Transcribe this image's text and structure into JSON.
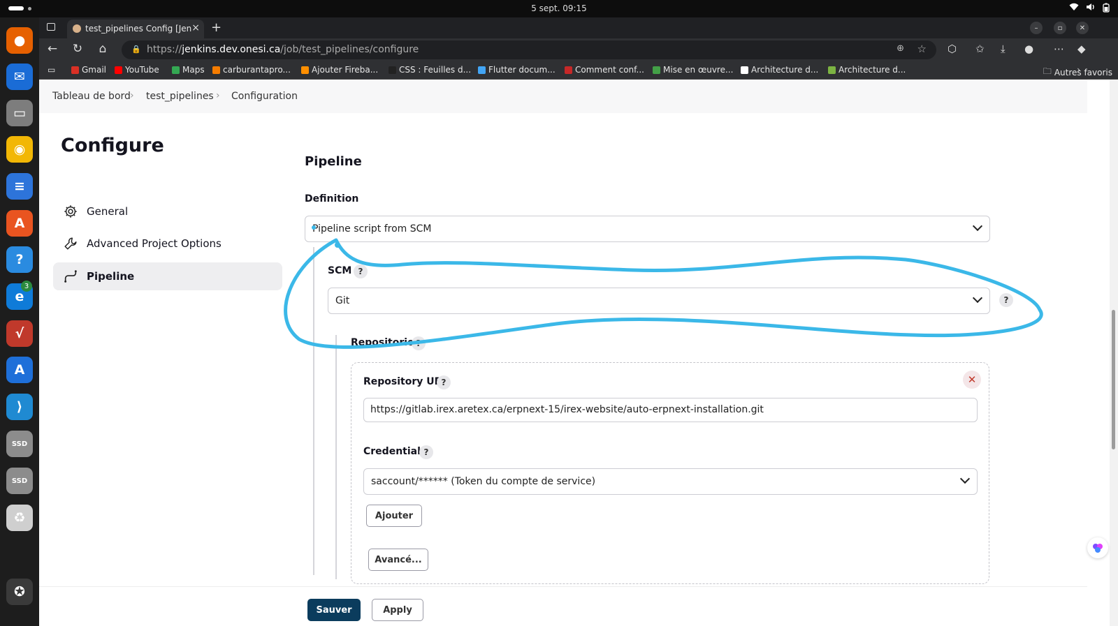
{
  "system": {
    "clock": "5 sept.  09:15",
    "tray_icons": [
      "wifi-icon",
      "volume-icon",
      "battery-icon"
    ]
  },
  "dock": {
    "apps": [
      {
        "name": "firefox",
        "color": "#e66000",
        "glyph": "●"
      },
      {
        "name": "thunderbird",
        "color": "#1a6cd6",
        "glyph": "✉"
      },
      {
        "name": "files",
        "color": "#7d7d7d",
        "glyph": "▭"
      },
      {
        "name": "rhythmbox",
        "color": "#f2b705",
        "glyph": "◉"
      },
      {
        "name": "writer",
        "color": "#2d74da",
        "glyph": "≡"
      },
      {
        "name": "app-center",
        "color": "#e95420",
        "glyph": "A"
      },
      {
        "name": "help",
        "color": "#2a8be0",
        "glyph": "?"
      },
      {
        "name": "edge",
        "color": "#0f7bd8",
        "glyph": "e",
        "badge": "3"
      },
      {
        "name": "math",
        "color": "#c0392b",
        "glyph": "√"
      },
      {
        "name": "app-store",
        "color": "#1e6fd9",
        "glyph": "A"
      },
      {
        "name": "vscode",
        "color": "#1f8ad2",
        "glyph": "⟩"
      },
      {
        "name": "ssd-1",
        "color": "#8c8c8c",
        "glyph": "SSD"
      },
      {
        "name": "ssd-2",
        "color": "#8c8c8c",
        "glyph": "SSD"
      },
      {
        "name": "trash",
        "color": "#cfcfcf",
        "glyph": "♻"
      },
      {
        "name": "ubuntu",
        "color": "#3a3a3a",
        "glyph": "✪"
      }
    ]
  },
  "browser": {
    "tab_title": "test_pipelines Config [Jen",
    "url_host": "https://jenkins.dev.onesi.ca",
    "url_host_prefix": "https://",
    "url_host_name": "jenkins.dev.onesi.ca",
    "url_path": "/job/test_pipelines/configure",
    "bookmarks": [
      {
        "label": "Gmail",
        "color": "#d93025"
      },
      {
        "label": "YouTube",
        "color": "#ff0000"
      },
      {
        "label": "Maps",
        "color": "#34a853"
      },
      {
        "label": "carburantapro...",
        "color": "#f57c00"
      },
      {
        "label": "Ajouter Fireba...",
        "color": "#ff8f00"
      },
      {
        "label": "CSS : Feuilles d...",
        "color": "#222222"
      },
      {
        "label": "Flutter docum...",
        "color": "#42a5f5"
      },
      {
        "label": "Comment conf...",
        "color": "#c62828"
      },
      {
        "label": "Mise en œuvre...",
        "color": "#43a047"
      },
      {
        "label": "Architecture d...",
        "color": "#ffffff"
      },
      {
        "label": "Architecture d...",
        "color": "#7cb342"
      }
    ],
    "other_bookmarks": "Autres favoris"
  },
  "jenkins": {
    "breadcrumbs": [
      "Tableau de bord",
      "test_pipelines",
      "Configuration"
    ],
    "page_title": "Configure",
    "sidebar": [
      {
        "label": "General",
        "icon": "gear-icon"
      },
      {
        "label": "Advanced Project Options",
        "icon": "wrench-icon"
      },
      {
        "label": "Pipeline",
        "icon": "pipeline-icon",
        "active": true
      }
    ],
    "section_title": "Pipeline",
    "definition_label": "Definition",
    "definition_value": "Pipeline script from SCM",
    "scm_label": "SCM",
    "scm_value": "Git",
    "repositories_label": "Repositories",
    "repo_url_label": "Repository URL",
    "repo_url_value": "https://gitlab.irex.aretex.ca/erpnext-15/irex-website/auto-erpnext-installation.git",
    "credentials_label": "Credentials",
    "credentials_value": "saccount/****** (Token du compte de service)",
    "add_button": "Ajouter",
    "advanced_button": "Avancé...",
    "save_button": "Sauver",
    "apply_button": "Apply",
    "help_glyph": "?",
    "annotation_color": "#3bb8e8"
  }
}
